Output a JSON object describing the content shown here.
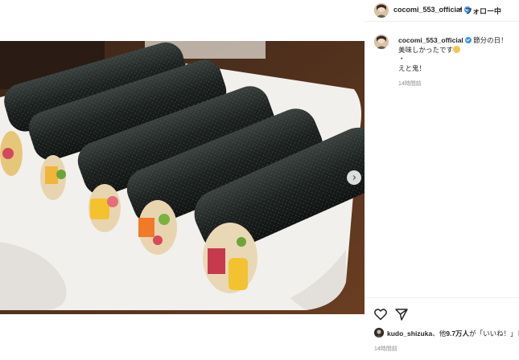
{
  "header": {
    "username": "cocomi_553_official",
    "separator": "•",
    "follow_label": "フォロー中"
  },
  "caption": {
    "username": "cocomi_553_official",
    "lines": [
      "節分の日！",
      "美味しかったです",
      "・",
      "えと鬼！"
    ],
    "time": "14時間前"
  },
  "likes": {
    "user": "kudo_shizuka",
    "mid": "、他",
    "count": "9.7万人",
    "suffix": "が「いいね！」し"
  },
  "post_time": "14時間前",
  "icons": {
    "like": "heart-icon",
    "share": "paper-plane-icon",
    "verified": "verified-badge-icon",
    "next": "chevron-right-icon",
    "emoji": "smiling-face-emoji-icon"
  },
  "colors": {
    "verified": "#3897f0",
    "meta_text": "#8e8e8e",
    "plate": "#f2f0ec",
    "seaweed": "#1f2422"
  }
}
